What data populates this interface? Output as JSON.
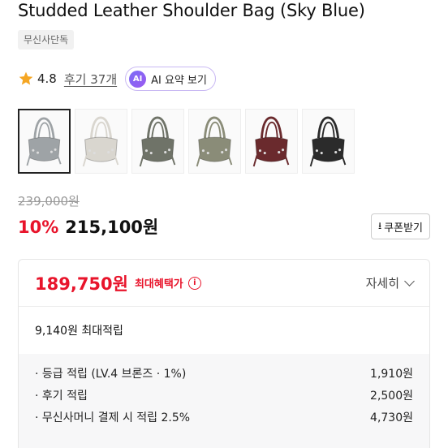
{
  "product": {
    "title": "Studded Leather Shoulder Bag (Sky Blue)",
    "badge": "무신사단독",
    "rating": "4.8",
    "reviews_label": "후기 37개",
    "ai_chip": "AI",
    "ai_label": "AI 요약 보기"
  },
  "thumbnails": [
    {
      "color": "#9ea3a6",
      "label": "sky-blue"
    },
    {
      "color": "#d9d6cf",
      "label": "ivory"
    },
    {
      "color": "#6f7368",
      "label": "khaki"
    },
    {
      "color": "#8a8c78",
      "label": "olive"
    },
    {
      "color": "#6a2a2d",
      "label": "burgundy"
    },
    {
      "color": "#2b2b2b",
      "label": "black"
    }
  ],
  "pricing": {
    "original": "239,000원",
    "discount": "10%",
    "price": "215,100원",
    "coupon_label": "쿠폰받기",
    "coupon_icon": "download-icon"
  },
  "benefit": {
    "max_price": "189,750원",
    "max_label": "최대혜택가",
    "info_glyph": "i",
    "detail_label": "자세히",
    "points_total": "9,140원 최대적립",
    "rows": [
      {
        "label": "· 등급 적립 (LV.4 브론즈 · 1%)",
        "value": "1,910원"
      },
      {
        "label": "· 후기 적립",
        "value": "2,500원"
      },
      {
        "label": "· 무신사머니 결제 시 적립 2.5%",
        "value": "4,730원"
      }
    ]
  },
  "colors": {
    "accent_red": "#e8142b",
    "star": "#f5a623",
    "ai_purple": "#7b6cf6"
  }
}
